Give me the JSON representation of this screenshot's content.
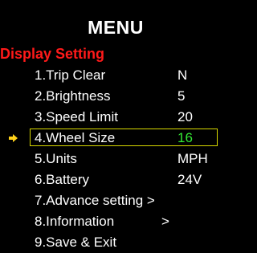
{
  "menu": {
    "title": "MENU",
    "section": "Display Setting",
    "items": [
      {
        "label": "1.Trip Clear",
        "value": "N"
      },
      {
        "label": "2.Brightness",
        "value": "5"
      },
      {
        "label": "3.Speed Limit",
        "value": "20"
      },
      {
        "label": "4.Wheel Size",
        "value": "16",
        "selected": true
      },
      {
        "label": "5.Units",
        "value": "MPH"
      },
      {
        "label": "6.Battery",
        "value": "24V"
      },
      {
        "label": "7.Advance setting >",
        "value": ""
      },
      {
        "label": "8.Information",
        "value": ">"
      },
      {
        "label": "9.Save & Exit",
        "value": ""
      }
    ]
  },
  "colors": {
    "background": "#000000",
    "text": "#ffffff",
    "section": "#ff1a1a",
    "selection_border": "#d9d900",
    "selected_value": "#33e633",
    "pointer": "#ffd21a"
  },
  "icons": {
    "pointer": "arrow-right-icon"
  }
}
